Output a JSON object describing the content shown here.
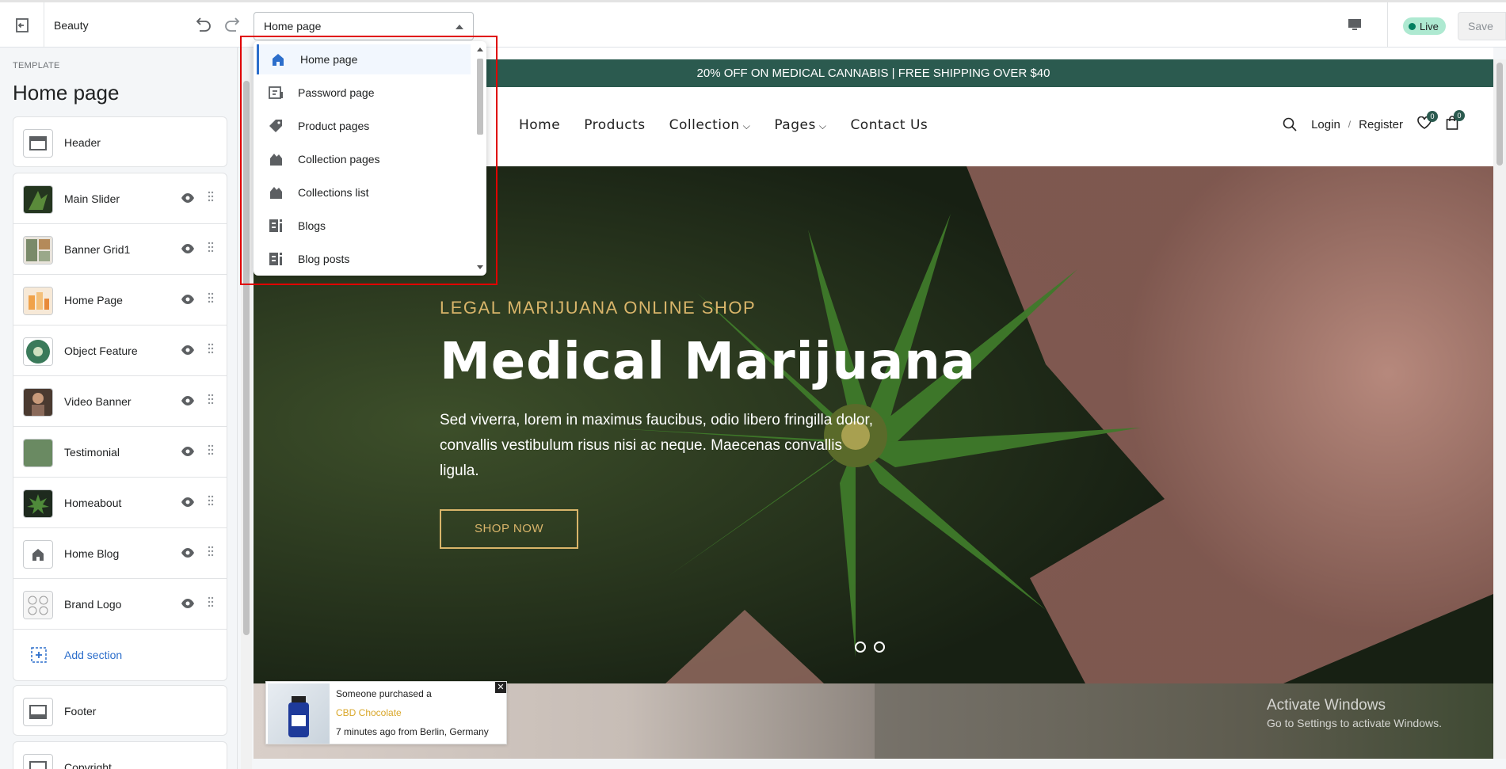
{
  "topbar": {
    "store_name": "Beauty",
    "template_select_value": "Home page",
    "live_label": "Live",
    "save_label": "Save"
  },
  "sidebar": {
    "kicker": "TEMPLATE",
    "title": "Home page",
    "header_section": "Header",
    "sections": [
      {
        "label": "Main Slider",
        "thumb": "slider-thumbnail"
      },
      {
        "label": "Banner Grid1",
        "thumb": "banner-grid-thumbnail"
      },
      {
        "label": "Home Page",
        "thumb": "products-thumbnail"
      },
      {
        "label": "Object Feature",
        "thumb": "feature-thumbnail"
      },
      {
        "label": "Video Banner",
        "thumb": "video-thumbnail"
      },
      {
        "label": "Testimonial",
        "thumb": "testimonial-thumbnail"
      },
      {
        "label": "Homeabout",
        "thumb": "about-thumbnail"
      },
      {
        "label": "Home Blog",
        "thumb": "home-icon"
      },
      {
        "label": "Brand Logo",
        "thumb": "brand-logo-thumbnail"
      }
    ],
    "add_section_label": "Add section",
    "footer_sections": [
      "Footer",
      "Copyright"
    ]
  },
  "dropdown": {
    "items": [
      {
        "label": "Home page",
        "icon": "home-icon",
        "selected": true
      },
      {
        "label": "Password page",
        "icon": "password-page-icon"
      },
      {
        "label": "Product pages",
        "icon": "tag-icon"
      },
      {
        "label": "Collection pages",
        "icon": "collection-icon"
      },
      {
        "label": "Collections list",
        "icon": "collection-icon"
      },
      {
        "label": "Blogs",
        "icon": "blog-icon"
      },
      {
        "label": "Blog posts",
        "icon": "blog-icon"
      }
    ]
  },
  "preview": {
    "promo_text": "20% OFF ON MEDICAL CANNABIS | FREE SHIPPING OVER $40",
    "nav": [
      "Home",
      "Products",
      "Collection",
      "Pages",
      "Contact Us"
    ],
    "login_label": "Login",
    "separator": "/",
    "register_label": "Register",
    "wishlist_count": "0",
    "cart_count": "0",
    "hero": {
      "kicker": "LEGAL MARIJUANA ONLINE SHOP",
      "title": "Medical Marijuana",
      "text": "Sed viverra, lorem in maximus faucibus, odio libero fringilla dolor, convallis vestibulum risus nisi ac neque. Maecenas convallis ligula.",
      "button": "SHOP NOW"
    },
    "toast": {
      "line1": "Someone purchased a",
      "product": "CBD Chocolate",
      "line3": "7 minutes ago from Berlin, Germany",
      "close": "✕"
    },
    "activate_windows": {
      "title": "Activate Windows",
      "subtitle": "Go to Settings to activate Windows."
    }
  },
  "colors": {
    "accent": "#2c6ecb",
    "promo_bg": "#2b5a4f",
    "gold": "#d9b56a",
    "highlight": "#e00000"
  }
}
